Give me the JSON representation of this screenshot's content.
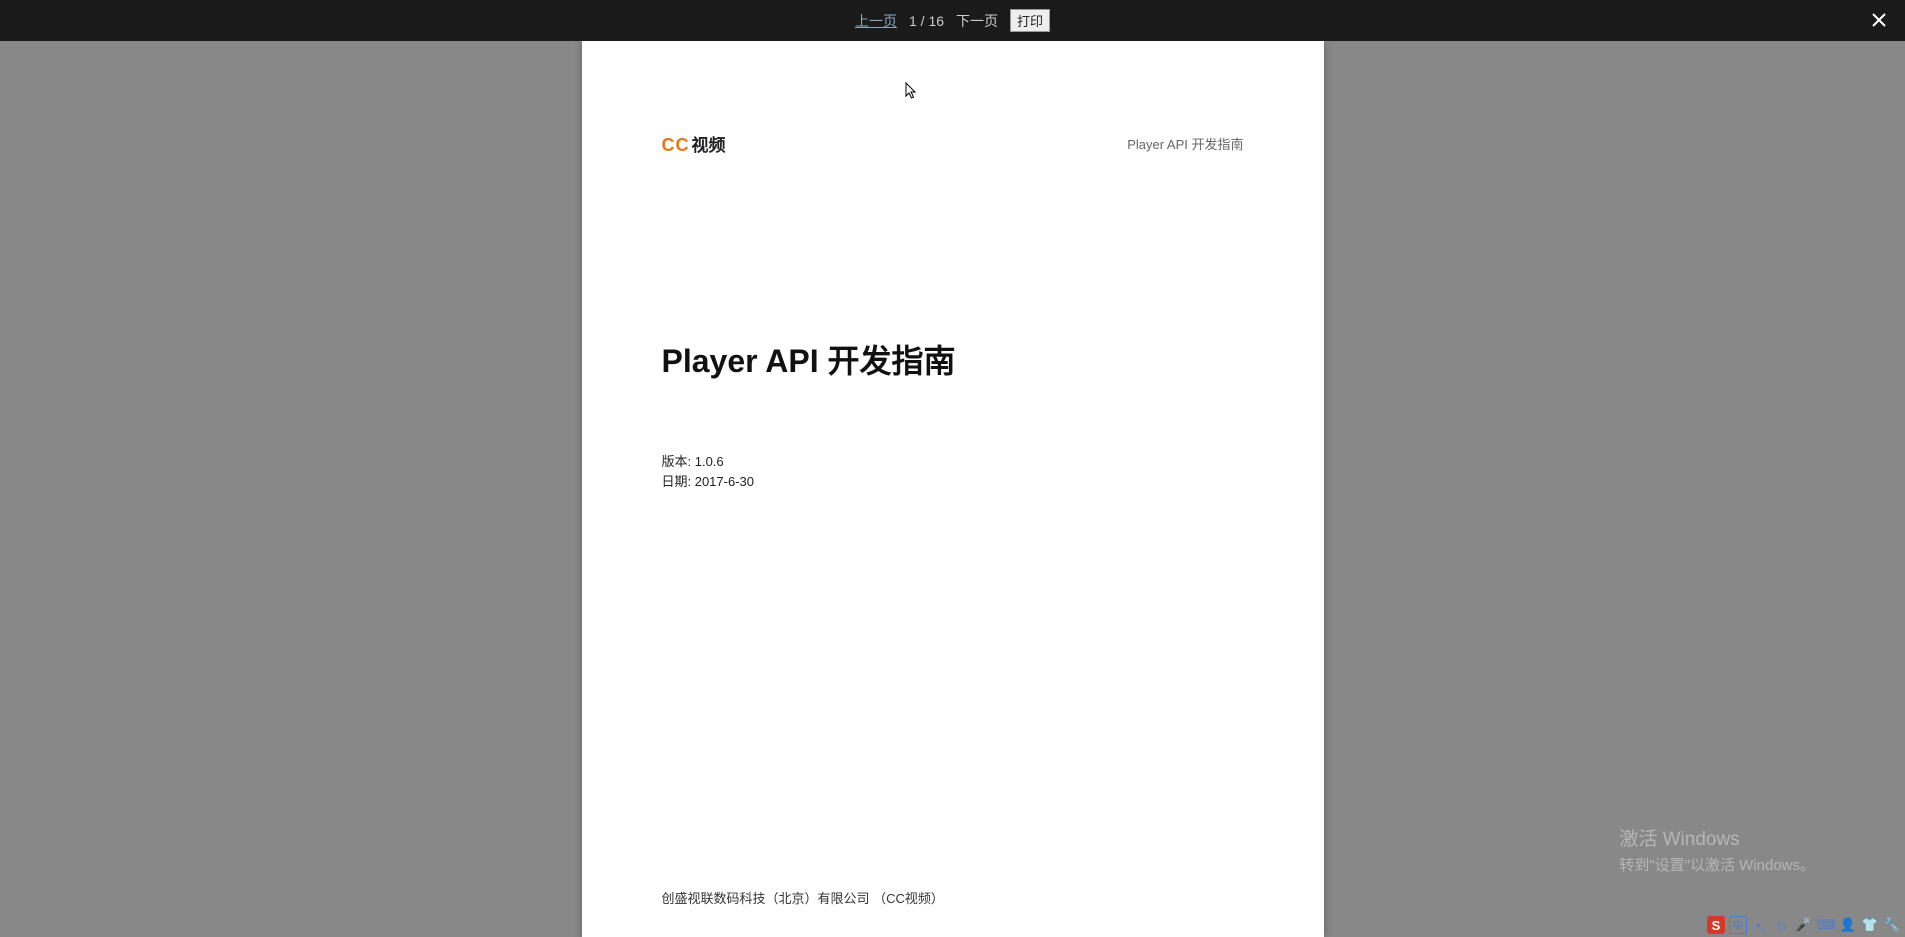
{
  "toolbar": {
    "prev": "上一页",
    "page_current": "1",
    "page_sep": " / ",
    "page_total": "16",
    "next": "下一页",
    "print": "打印"
  },
  "document": {
    "logo_prefix": "CC",
    "logo_text": "视频",
    "header_right": "Player API 开发指南",
    "title": "Player API 开发指南",
    "version_line": "版本: 1.0.6",
    "date_line": "日期: 2017-6-30",
    "company": "创盛视联数码科技（北京）有限公司  （CC视频）"
  },
  "watermark": {
    "title": "激活 Windows",
    "sub": "转到\"设置\"以激活 Windows。"
  }
}
